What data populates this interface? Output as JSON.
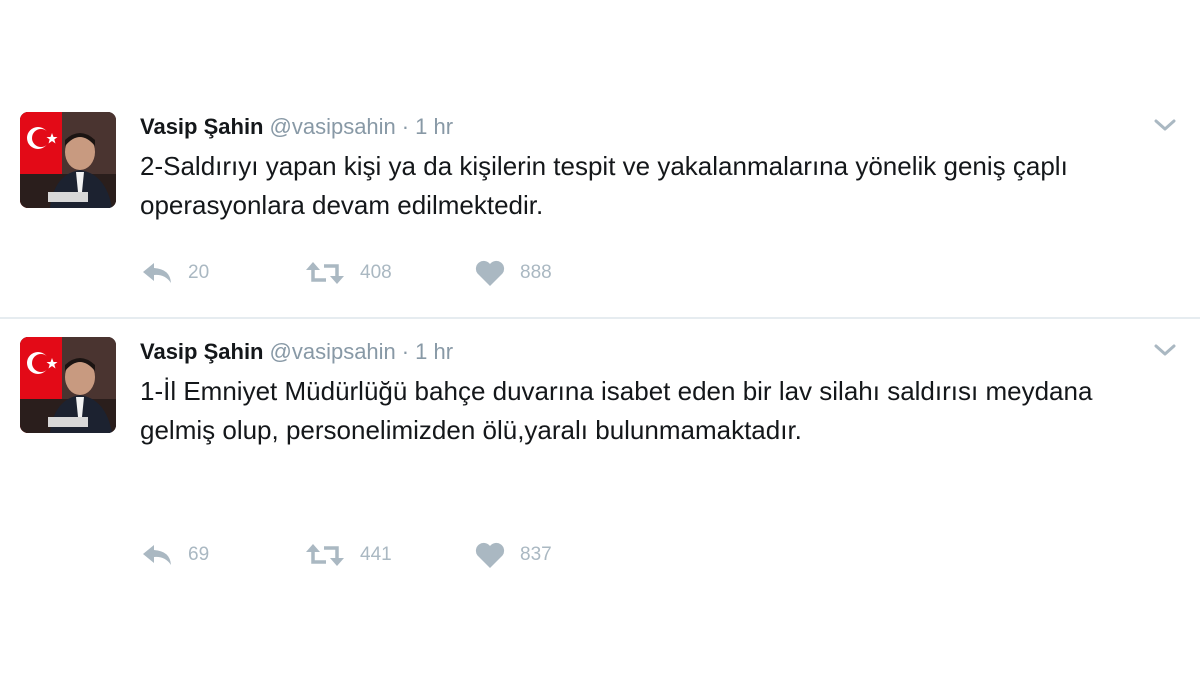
{
  "tweets": [
    {
      "author": {
        "name": "Vasip Şahin",
        "handle": "@vasipsahin"
      },
      "separator": "·",
      "time": "1 hr",
      "text": "2-Saldırıyı yapan kişi ya da kişilerin tespit ve yakalanmalarına yönelik geniş çaplı operasyonlara devam edilmektedir.",
      "replies": "20",
      "retweets": "408",
      "likes": "888"
    },
    {
      "author": {
        "name": "Vasip Şahin",
        "handle": "@vasipsahin"
      },
      "separator": "·",
      "time": "1 hr",
      "text": "1-İl Emniyet Müdürlüğü bahçe duvarına isabet eden bir lav silahı saldırısı meydana gelmiş olup,  personelimizden ölü,yaralı bulunmamaktadır.",
      "replies": "69",
      "retweets": "441",
      "likes": "837"
    }
  ],
  "icons": {
    "reply": "reply-icon",
    "retweet": "retweet-icon",
    "like": "heart-icon",
    "menu": "chevron-down-icon"
  },
  "colors": {
    "text": "#14171a",
    "muted": "#8899a6",
    "action": "#aab8c2",
    "divider": "#e6ecf0",
    "flag_red": "#e30a17"
  }
}
